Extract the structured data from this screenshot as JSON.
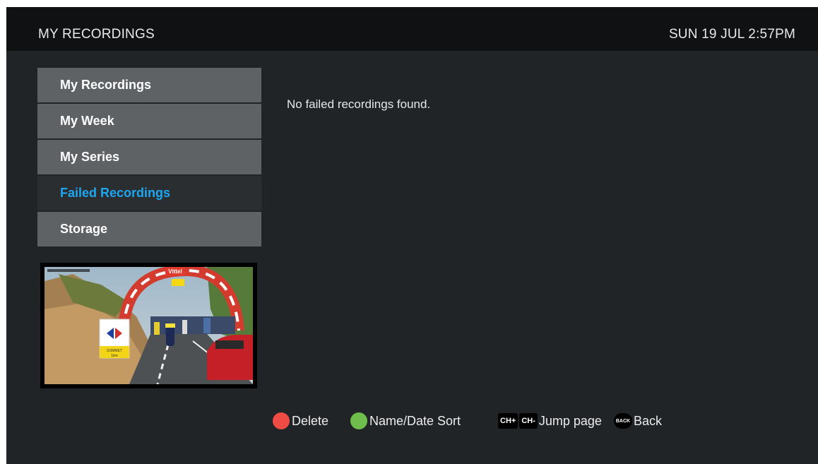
{
  "header": {
    "title": "MY RECORDINGS",
    "datetime": "SUN 19 JUL 2:57PM"
  },
  "menu": {
    "items": [
      {
        "label": "My Recordings"
      },
      {
        "label": "My Week"
      },
      {
        "label": "My Series"
      },
      {
        "label": "Failed Recordings",
        "selected": true
      },
      {
        "label": "Storage"
      }
    ]
  },
  "main": {
    "message": "No failed recordings found."
  },
  "preview": {
    "sign_text": "SOMMET",
    "sign_distance": "1km",
    "banner_text": "Vittel"
  },
  "footer": {
    "delete_label": "Delete",
    "sort_label": "Name/Date Sort",
    "ch_plus": "CH+",
    "ch_minus": "CH-",
    "jump_label": "Jump page",
    "back_key": "BACK",
    "back_label": "Back"
  },
  "colors": {
    "accent": "#1da7f1",
    "red_key": "#ef4b45",
    "green_key": "#6fbe4b",
    "menu_bg": "#5f6265",
    "header_bg": "#0f1112",
    "screen_bg": "#212427"
  }
}
